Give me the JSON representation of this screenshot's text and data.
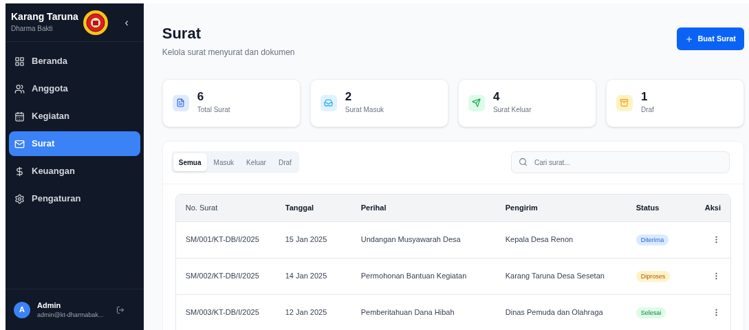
{
  "sidebar": {
    "title": "Karang Taruna",
    "subtitle": "Dharma Bakti",
    "collapse": "‹",
    "items": [
      {
        "label": "Beranda",
        "selected": false
      },
      {
        "label": "Anggota",
        "selected": false
      },
      {
        "label": "Kegiatan",
        "selected": false
      },
      {
        "label": "Surat",
        "selected": true
      },
      {
        "label": "Keuangan",
        "selected": false
      },
      {
        "label": "Pengaturan",
        "selected": false
      }
    ],
    "user": {
      "initial": "A",
      "name": "Admin",
      "email": "admin@kt-dharmabak..."
    }
  },
  "header": {
    "title": "Surat",
    "subtitle": "Kelola surat menyurat dan dokumen",
    "button": "Buat Surat"
  },
  "stats": [
    {
      "value": "6",
      "label": "Total Surat",
      "kind": "total"
    },
    {
      "value": "2",
      "label": "Surat Masuk",
      "kind": "inbox"
    },
    {
      "value": "4",
      "label": "Surat Keluar",
      "kind": "sent"
    },
    {
      "value": "1",
      "label": "Draf",
      "kind": "draft"
    }
  ],
  "tabs": [
    {
      "label": "Semua",
      "selected": true
    },
    {
      "label": "Masuk",
      "selected": false
    },
    {
      "label": "Keluar",
      "selected": false
    },
    {
      "label": "Draf",
      "selected": false
    }
  ],
  "search": {
    "placeholder": "Cari surat..."
  },
  "table": {
    "columns": [
      "No. Surat",
      "Tanggal",
      "Perihal",
      "Pengirim",
      "Status",
      "Aksi"
    ],
    "rows": [
      {
        "number": "SM/001/KT-DB/I/2025",
        "date": "15 Jan 2025",
        "subject": "Undangan Musyawarah Desa",
        "sender": "Kepala Desa Renon",
        "status": {
          "label": "Diterima",
          "kind": "received"
        }
      },
      {
        "number": "SM/002/KT-DB/I/2025",
        "date": "14 Jan 2025",
        "subject": "Permohonan Bantuan Kegiatan",
        "sender": "Karang Taruna Desa Sesetan",
        "status": {
          "label": "Diproses",
          "kind": "processing"
        }
      },
      {
        "number": "SM/003/KT-DB/I/2025",
        "date": "12 Jan 2025",
        "subject": "Pemberitahuan Dana Hibah",
        "sender": "Dinas Pemuda dan Olahraga",
        "status": {
          "label": "Selesai",
          "kind": "done"
        }
      }
    ]
  }
}
